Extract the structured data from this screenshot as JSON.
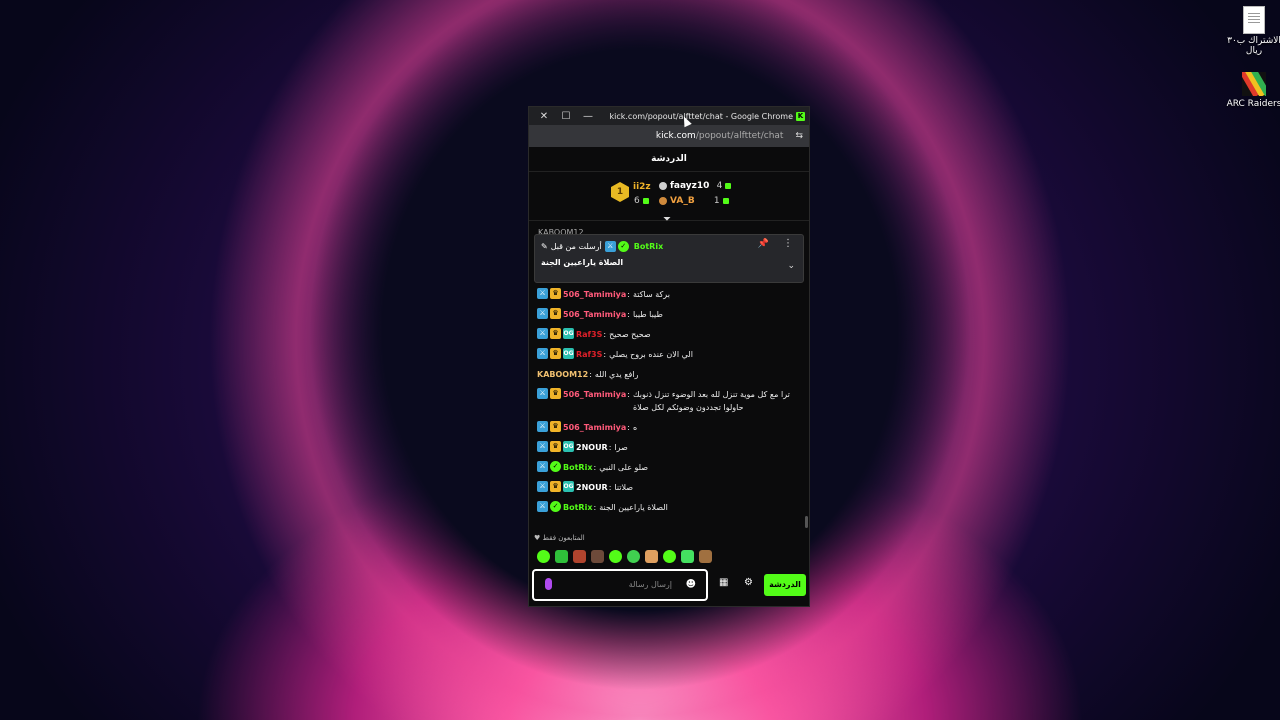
{
  "desktop": {
    "icons": [
      {
        "label": "الاشتراك ب٣٠ ريال",
        "icon": "document-icon"
      },
      {
        "label": "ARC Raiders",
        "icon": "arc-raiders-icon"
      }
    ]
  },
  "window": {
    "title": "kick.com/popout/alfttet/chat - Google Chrome",
    "url_host": "kick.com",
    "url_path": "/popout/alfttet/chat"
  },
  "chat": {
    "header": "الدردشة",
    "leaderboard": {
      "rank_badge": "1",
      "entries": [
        {
          "name": "ii2z",
          "count": "6",
          "color": "#f0b429"
        },
        {
          "name": "faayz10",
          "count": "4",
          "color": "#ffffff"
        },
        {
          "name": "VA_B",
          "count": "1",
          "color": "#f0a040"
        }
      ]
    },
    "hidden_peek": "KABOOM12",
    "pinned": {
      "user": "BotRix",
      "pinned_by": "أرسلت من قبل",
      "message": "الصلاة ياراعيين الجنة"
    },
    "messages": [
      {
        "badges": [
          "mod",
          "crown"
        ],
        "user": "506_Tamimiya",
        "color": "#ff5a7a",
        "text": "بركة ساكتة"
      },
      {
        "badges": [
          "mod",
          "crown"
        ],
        "user": "506_Tamimiya",
        "color": "#ff5a7a",
        "text": "طيبا طيبا"
      },
      {
        "badges": [
          "mod",
          "crown",
          "og"
        ],
        "user": "Raf3S",
        "color": "#e0202a",
        "text": "صحيح صحيح"
      },
      {
        "badges": [
          "mod",
          "crown",
          "og"
        ],
        "user": "Raf3S",
        "color": "#e0202a",
        "text": "الي الان عنده بروح يصلي"
      },
      {
        "badges": [],
        "user": "KABOOM12",
        "color": "#f0c070",
        "text": "رافع يدي الله"
      },
      {
        "badges": [
          "mod",
          "crown"
        ],
        "user": "506_Tamimiya",
        "color": "#ff5a7a",
        "text": "ترا مع كل موية تنزل لله بعد الوضوء تنزل ذنوبك حاولوا تجددون وضوئكم لكل صلاة"
      },
      {
        "badges": [
          "mod",
          "crown"
        ],
        "user": "506_Tamimiya",
        "color": "#ff5a7a",
        "text": "ه"
      },
      {
        "badges": [
          "mod",
          "crown",
          "og"
        ],
        "user": "2NOUR",
        "color": "#ffffff",
        "text": "صرا"
      },
      {
        "badges": [
          "mod",
          "verified"
        ],
        "user": "BotRix",
        "color": "#53fc18",
        "text": "صلو على النبي"
      },
      {
        "badges": [
          "mod",
          "crown",
          "og"
        ],
        "user": "2NOUR",
        "color": "#ffffff",
        "text": "صلاتنا"
      },
      {
        "badges": [
          "mod",
          "verified"
        ],
        "user": "BotRix",
        "color": "#53fc18",
        "text": "الصلاة ياراعيين الجنة"
      }
    ],
    "subs_label": "المتابعون فقط",
    "input_placeholder": "إرسال رسالة",
    "send_label": "الدردشة"
  }
}
